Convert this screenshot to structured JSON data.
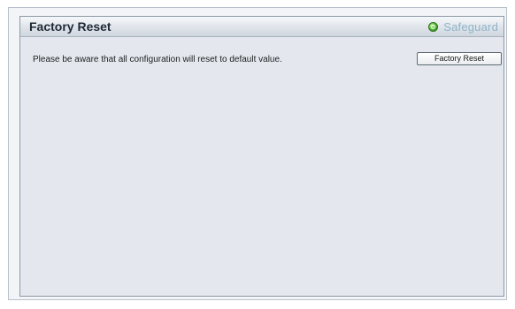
{
  "panel": {
    "title": "Factory Reset",
    "safeguard_label": "Safeguard"
  },
  "content": {
    "notice": "Please be aware that all configuration will reset to default value.",
    "reset_button_label": "Factory Reset"
  },
  "icons": {
    "safeguard": "status-led-icon"
  },
  "colors": {
    "panel_background": "#e4e8ee",
    "title_text": "#1f2a36",
    "safeguard_text": "#8fb4c9",
    "safeguard_led": "#58c238"
  }
}
